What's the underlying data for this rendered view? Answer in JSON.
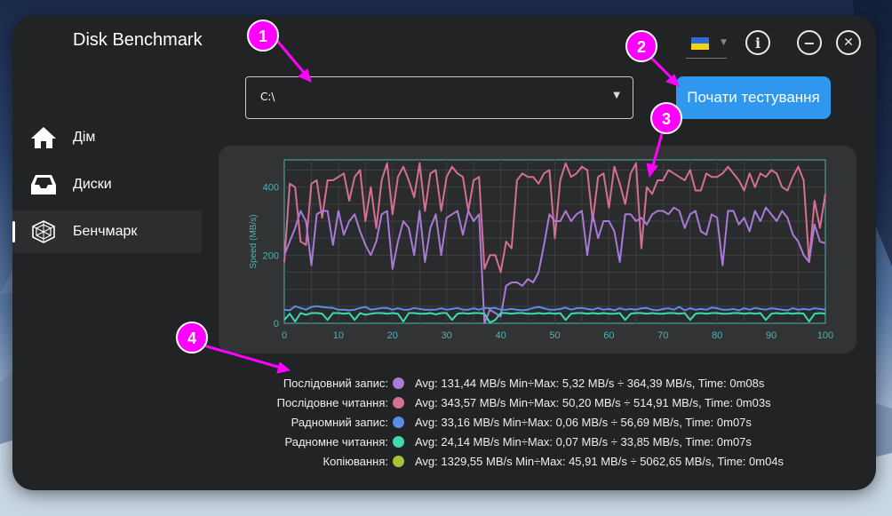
{
  "app": {
    "title": "Disk Benchmark"
  },
  "header": {
    "language_flag": "ukraine-flag-icon",
    "info_icon": "i",
    "minimize_icon": "−",
    "close_icon": "✕"
  },
  "sidebar": {
    "items": [
      {
        "label": "Дім",
        "icon": "home-icon",
        "active": false
      },
      {
        "label": "Диски",
        "icon": "inbox-tray-icon",
        "active": false
      },
      {
        "label": "Бенчмарк",
        "icon": "benchmark-icon",
        "active": true
      }
    ]
  },
  "drive_select": {
    "value": "C:\\"
  },
  "start_button": {
    "label": "Почати тестування"
  },
  "annotations": [
    "1",
    "2",
    "3",
    "4"
  ],
  "colors": {
    "seq_write": "#a97ad6",
    "seq_read": "#d56f95",
    "rand_write": "#5a8ee6",
    "rand_read": "#3fd9b0",
    "copy": "#a6c23a",
    "accent": "#2f98ee",
    "annotation": "#ff00ff"
  },
  "chart_data": {
    "type": "line",
    "xlabel": "",
    "ylabel": "Speed (MB/s)",
    "xlim": [
      0,
      100
    ],
    "ylim": [
      0,
      480
    ],
    "xticks": [
      0,
      10,
      20,
      30,
      40,
      50,
      60,
      70,
      80,
      90,
      100
    ],
    "yticks": [
      0,
      200,
      400
    ],
    "grid": true,
    "series": [
      {
        "key": "seq_read",
        "values": [
          180,
          410,
          400,
          240,
          230,
          410,
          420,
          310,
          420,
          420,
          430,
          440,
          360,
          430,
          450,
          300,
          400,
          280,
          420,
          470,
          320,
          430,
          460,
          420,
          370,
          470,
          330,
          440,
          450,
          330,
          430,
          460,
          440,
          430,
          330,
          420,
          430,
          160,
          200,
          200,
          150,
          240,
          220,
          420,
          440,
          430,
          430,
          410,
          440,
          450,
          250,
          420,
          470,
          430,
          440,
          460,
          450,
          300,
          430,
          440,
          340,
          460,
          410,
          350,
          440,
          470,
          220,
          400,
          380,
          420,
          420,
          450,
          440,
          430,
          420,
          450,
          390,
          390,
          440,
          430,
          430,
          440,
          460,
          440,
          420,
          390,
          440,
          400,
          440,
          430,
          450,
          440,
          400,
          390,
          430,
          460,
          420,
          180,
          360,
          280,
          380
        ]
      },
      {
        "key": "seq_write",
        "values": [
          200,
          240,
          280,
          330,
          300,
          170,
          320,
          330,
          330,
          230,
          330,
          260,
          300,
          320,
          270,
          230,
          200,
          240,
          320,
          330,
          160,
          240,
          300,
          280,
          200,
          330,
          180,
          280,
          320,
          200,
          310,
          320,
          330,
          260,
          330,
          300,
          320,
          0,
          40,
          30,
          20,
          110,
          120,
          120,
          110,
          130,
          120,
          150,
          230,
          320,
          300,
          300,
          330,
          300,
          320,
          330,
          200,
          320,
          250,
          300,
          300,
          270,
          180,
          320,
          320,
          300,
          310,
          290,
          320,
          330,
          330,
          320,
          340,
          330,
          280,
          320,
          330,
          270,
          260,
          320,
          310,
          170,
          330,
          330,
          290,
          310,
          270,
          330,
          300,
          340,
          320,
          300,
          330,
          310,
          260,
          240,
          200,
          180,
          290,
          240,
          235
        ]
      },
      {
        "key": "rand_write",
        "values": [
          40,
          38,
          50,
          45,
          40,
          48,
          50,
          48,
          46,
          45,
          40,
          40,
          38,
          40,
          45,
          48,
          40,
          42,
          45,
          45,
          40,
          44,
          40,
          40,
          45,
          42,
          40,
          40,
          40,
          44,
          40,
          42,
          45,
          40,
          40,
          44,
          40,
          45,
          44,
          45,
          40,
          40,
          42,
          40,
          38,
          40,
          45,
          48,
          44,
          40,
          40,
          42,
          46,
          40,
          44,
          45,
          42,
          40,
          45,
          40,
          42,
          38,
          44,
          40,
          42,
          40,
          44,
          45,
          40,
          38,
          42,
          44,
          40,
          48,
          38,
          44,
          40,
          42,
          40,
          46,
          44,
          40,
          40,
          42,
          38,
          44,
          40,
          45,
          42,
          40,
          44,
          42,
          40,
          38,
          44,
          40,
          42,
          40,
          44,
          42,
          40
        ]
      },
      {
        "key": "rand_read",
        "values": [
          10,
          28,
          5,
          30,
          25,
          30,
          30,
          28,
          10,
          30,
          30,
          28,
          30,
          10,
          30,
          25,
          28,
          30,
          30,
          28,
          30,
          28,
          5,
          30,
          30,
          28,
          28,
          30,
          26,
          30,
          30,
          10,
          28,
          30,
          28,
          30,
          30,
          28,
          2,
          10,
          30,
          30,
          28,
          30,
          30,
          28,
          28,
          30,
          28,
          30,
          28,
          30,
          10,
          28,
          30,
          30,
          28,
          30,
          28,
          30,
          28,
          28,
          30,
          10,
          28,
          30,
          30,
          28,
          30,
          28,
          28,
          30,
          30,
          28,
          30,
          10,
          28,
          30,
          28,
          30,
          30,
          28,
          28,
          30,
          30,
          28,
          30,
          28,
          30,
          10,
          28,
          30,
          28,
          30,
          28,
          30,
          28,
          5,
          28,
          30,
          28
        ]
      }
    ]
  },
  "stats": [
    {
      "key": "seq_write",
      "label": "Послідовний запис:",
      "text": "Avg: 131,44 MB/s  Min÷Max: 5,32 MB/s ÷ 364,39 MB/s, Time: 0m08s"
    },
    {
      "key": "seq_read",
      "label": "Послідовне читання:",
      "text": "Avg: 343,57 MB/s  Min÷Max: 50,20 MB/s ÷ 514,91 MB/s, Time: 0m03s"
    },
    {
      "key": "rand_write",
      "label": "Радномний запис:",
      "text": "Avg: 33,16 MB/s  Min÷Max: 0,06 MB/s ÷ 56,69 MB/s, Time: 0m07s"
    },
    {
      "key": "rand_read",
      "label": "Радномне читання:",
      "text": "Avg: 24,14 MB/s  Min÷Max: 0,07 MB/s ÷ 33,85 MB/s, Time: 0m07s"
    },
    {
      "key": "copy",
      "label": "Копіювання:",
      "text": "Avg: 1329,55 MB/s  Min÷Max: 45,91 MB/s ÷ 5062,65 MB/s, Time: 0m04s"
    }
  ]
}
